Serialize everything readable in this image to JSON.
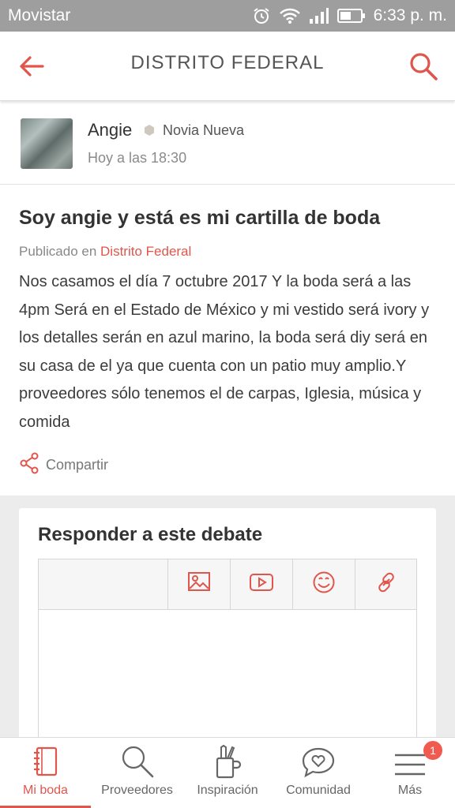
{
  "status_bar": {
    "carrier": "Movistar",
    "time": "6:33 p. m."
  },
  "header": {
    "title": "DISTRITO FEDERAL",
    "back_icon": "back-arrow-icon",
    "search_icon": "search-icon"
  },
  "author": {
    "name": "Angie",
    "badge": "Novia Nueva",
    "time": "Hoy a las 18:30"
  },
  "post": {
    "title": "Soy angie y está es mi cartilla de boda",
    "published_prefix": "Publicado en ",
    "published_location": "Distrito Federal",
    "body": "Nos casamos el día 7 octubre 2017 Y la boda será a las 4pm Será en el Estado de México y mi vestido será ivory y los detalles serán en azul marino, la boda será diy será en su casa de el ya que cuenta con un patio muy amplio.Y proveedores sólo tenemos el de carpas, Iglesia, música y comida",
    "share_label": "Compartir"
  },
  "reply": {
    "heading": "Responder a este debate"
  },
  "bottom_nav": {
    "items": [
      {
        "label": "Mi boda",
        "icon": "notebook-icon",
        "active": true
      },
      {
        "label": "Proveedores",
        "icon": "search-icon"
      },
      {
        "label": "Inspiración",
        "icon": "pencil-cup-icon"
      },
      {
        "label": "Comunidad",
        "icon": "chat-heart-icon"
      },
      {
        "label": "Más",
        "icon": "menu-icon"
      }
    ],
    "notification_count": "1"
  },
  "colors": {
    "accent": "#e0564c",
    "status_bar": "#9e9e9e"
  }
}
